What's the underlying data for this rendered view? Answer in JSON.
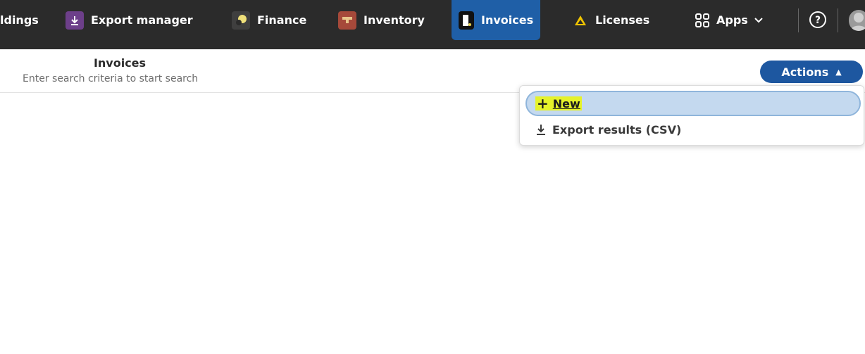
{
  "topnav": {
    "items": [
      {
        "label": "ldings",
        "icon": "none"
      },
      {
        "label": "Export manager",
        "icon": "download-icon",
        "color": "#6d3f8a"
      },
      {
        "label": "Finance",
        "icon": "finance-coin-icon",
        "color": "#3f3f3f"
      },
      {
        "label": "Inventory",
        "icon": "inventory-chest-icon",
        "color": "#a6493a"
      },
      {
        "label": "Invoices",
        "icon": "invoice-document-icon",
        "color": "#111111"
      },
      {
        "label": "Licenses",
        "icon": "license-triangle-icon",
        "color": "#f0c400"
      },
      {
        "label": "Apps",
        "icon": "apps-grid-icon"
      }
    ],
    "active": "Invoices",
    "active_color": "#1f5fa7"
  },
  "header": {
    "title": "Invoices",
    "subtitle": "Enter search criteria to start search"
  },
  "actions": {
    "label": "Actions",
    "color": "#1d57a0",
    "menu": {
      "new_label": "New",
      "export_label": "Export results (CSV)"
    }
  }
}
